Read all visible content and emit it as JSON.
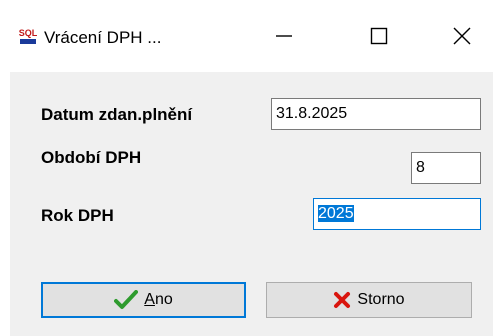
{
  "window": {
    "title": "Vrácení DPH ...",
    "app_icon_text": "SQL"
  },
  "form": {
    "datum_label": "Datum zdan.plnění",
    "datum_value": "31.8.2025",
    "obdobi_label": "Období DPH",
    "obdobi_value": "8",
    "rok_label": "Rok DPH",
    "rok_value": "2025"
  },
  "buttons": {
    "ok_label": "Ano",
    "ok_accel": "A",
    "ok_rest": "no",
    "cancel_label": "Storno"
  },
  "colors": {
    "accent": "#0078d7",
    "check": "#2e9b2e",
    "cross": "#d9150e"
  }
}
